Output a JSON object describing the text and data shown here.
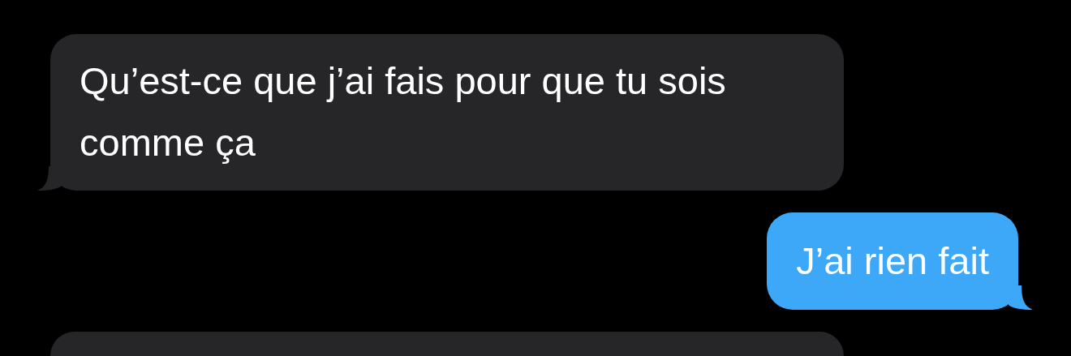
{
  "messages": [
    {
      "kind": "incoming",
      "text": "Qu’est-ce que j’ai fais pour que tu sois comme ça"
    },
    {
      "kind": "outgoing",
      "text": "J’ai rien fait"
    },
    {
      "kind": "incoming_cut"
    }
  ]
}
